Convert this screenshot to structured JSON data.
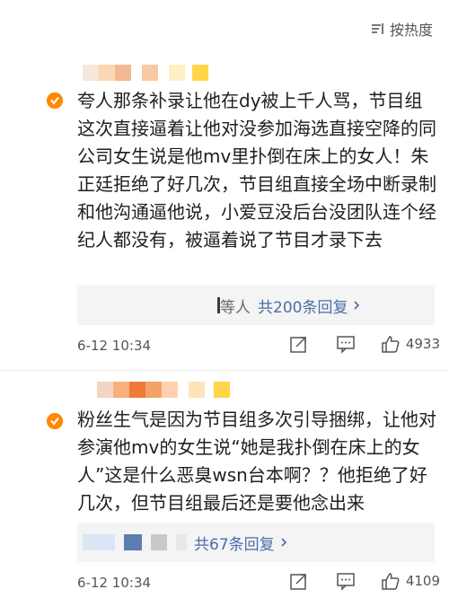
{
  "header": {
    "sort_label": "按热度"
  },
  "comments": [
    {
      "text": "夸人那条补录让他在dy被上千人骂，节目组这次直接逼着让他对没参加海选直接空降的同公司女生说是他mv里扑倒在床上的女人！朱正廷拒绝了好几次，节目组直接全场中断录制和他沟通逼他说，小爱豆没后台没团队连个经纪人都没有，被逼着说了节目才录下去",
      "reply_prefix": "等人",
      "reply_count": "共200条回复",
      "time": "6-12 10:34",
      "likes": "4933"
    },
    {
      "text": "粉丝生气是因为节目组多次引导捆绑，让他对参演他mv的女生说“她是我扑倒在床上的女人”这是什么恶臭wsn台本啊？？他拒绝了好几次，但节目组最后还是要他念出来",
      "reply_prefix": "",
      "reply_count": "共67条回复",
      "time": "6-12 10:34",
      "likes": "4109"
    }
  ],
  "icons": {
    "sort": "sort-icon",
    "verified": "verified-badge-icon",
    "share": "share-icon",
    "comment": "comment-icon",
    "like": "thumbs-up-icon",
    "chevron": "chevron-right-icon"
  },
  "colors": {
    "link": "#4a6ea8",
    "badge": "#ff8a00",
    "reply_bg": "#f4f4f4"
  }
}
